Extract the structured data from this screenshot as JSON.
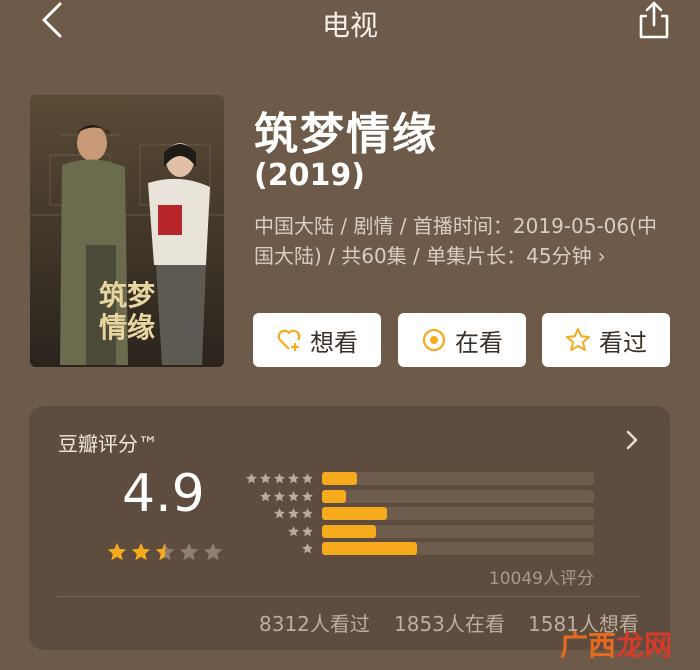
{
  "header": {
    "title": "电视",
    "back_icon": "chevron-left-icon",
    "share_icon": "share-icon"
  },
  "poster": {
    "title_text": "筑梦情缘"
  },
  "show": {
    "title": "筑梦情缘",
    "year": "(2019)",
    "meta_line1": "中国大陆 / 剧情 / 首播时间：2019-05-06(中",
    "meta_line2": "国大陆) / 共60集 / 单集片长：45分钟",
    "meta_chevron": "›"
  },
  "actions": [
    {
      "label": "想看",
      "icon": "heart-plus-icon"
    },
    {
      "label": "在看",
      "icon": "target-circle-icon"
    },
    {
      "label": "看过",
      "icon": "star-outline-icon"
    }
  ],
  "rating": {
    "card_title": "豆瓣评分™",
    "score": "4.9",
    "star_rating": 2.5,
    "distribution": [
      {
        "stars": 5,
        "fraction": 0.13
      },
      {
        "stars": 4,
        "fraction": 0.09
      },
      {
        "stars": 3,
        "fraction": 0.24
      },
      {
        "stars": 2,
        "fraction": 0.2
      },
      {
        "stars": 1,
        "fraction": 0.35
      }
    ],
    "count": "10049人评分",
    "stats": [
      "8312人看过",
      "1853人在看",
      "1581人想看"
    ]
  },
  "watermark": {
    "part1": "广西",
    "part2": "龙网"
  },
  "colors": {
    "background": "#6d5a48",
    "accent": "#f6ab1d",
    "card": "#5e4d3f"
  }
}
